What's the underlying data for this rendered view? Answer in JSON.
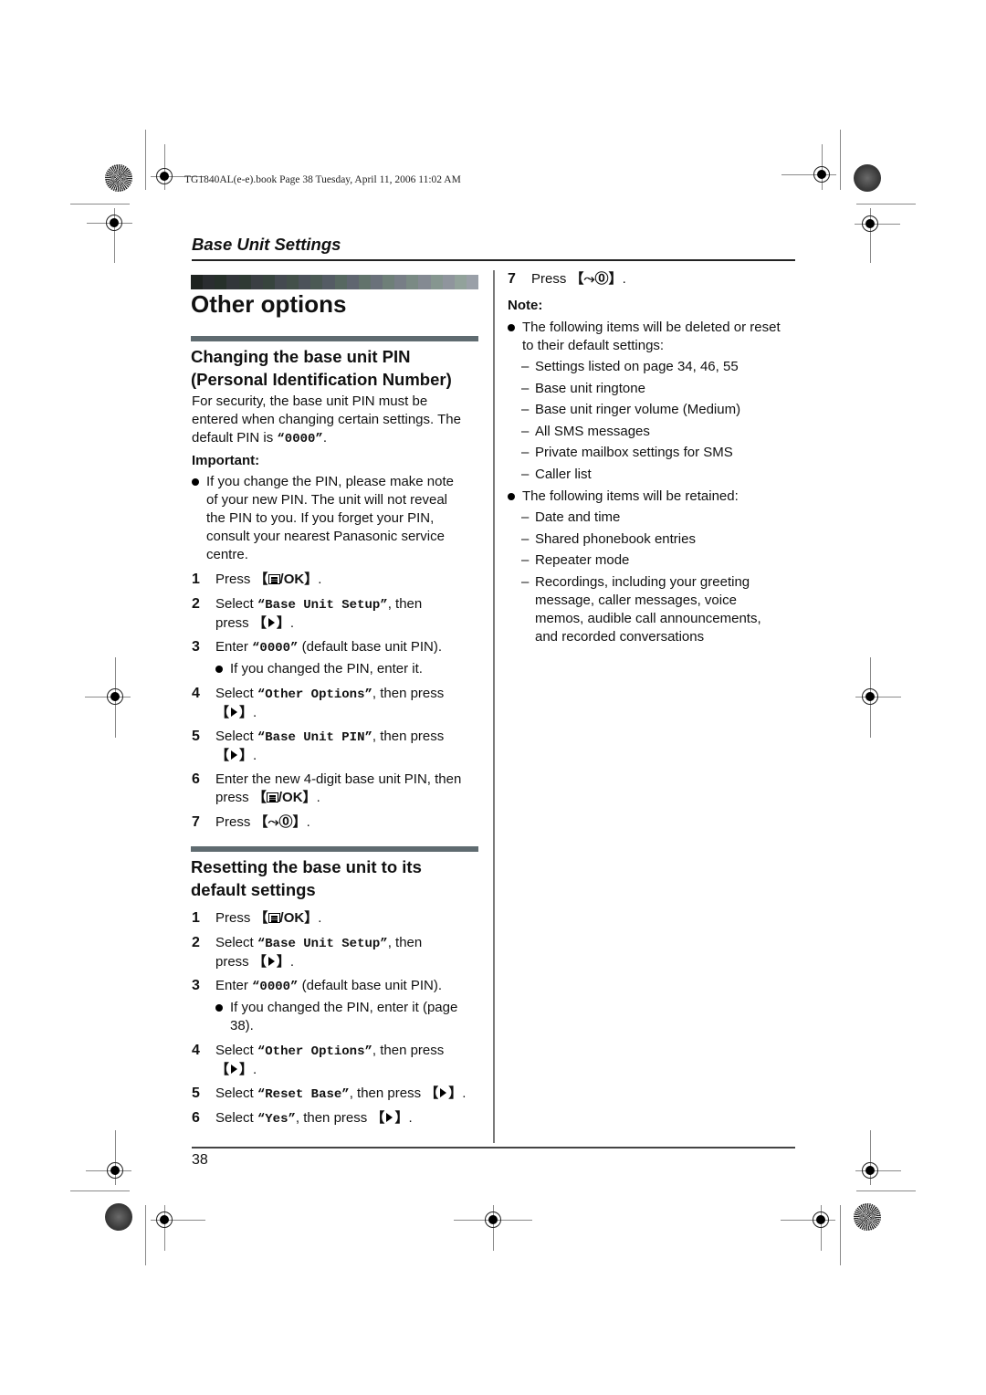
{
  "print_header": "TG1840AL(e-e).book  Page 38  Tuesday, April 11, 2006  11:02 AM",
  "section_title": "Base Unit Settings",
  "page_title": "Other options",
  "page_number": "38",
  "gradient_colors": [
    "#1e2320",
    "#2a2d30",
    "#26302a",
    "#32363a",
    "#2f3a34",
    "#3a3f43",
    "#37443e",
    "#444a50",
    "#43504a",
    "#4c525a",
    "#4b5a54",
    "#545c64",
    "#576861",
    "#5f6670",
    "#62736c",
    "#6a717a",
    "#6e7f78",
    "#777e86",
    "#7a8a84",
    "#848a92",
    "#869690",
    "#8f959d",
    "#92a29b",
    "#9aa0a8"
  ],
  "change_pin": {
    "heading_line1": "Changing the base unit PIN",
    "heading_line2": "(Personal Identification Number)",
    "intro_lines": [
      "For security, the base unit PIN must be",
      "entered when changing certain settings. The",
      "default PIN is "
    ],
    "intro_pin": "“0000”",
    "intro_end": ".",
    "important_label": "Important:",
    "important_lines": [
      "If you change the PIN, please make note",
      "of your new PIN. The unit will not reveal",
      "the PIN to you. If you forget your PIN,",
      "consult your nearest Panasonic service",
      "centre."
    ],
    "steps": [
      {
        "num": "1",
        "pre": "Press ",
        "key_open": "【",
        "key_text": "/OK",
        "key_close": "】",
        "post": "."
      },
      {
        "num": "2",
        "pre": "Select ",
        "code": "“Base Unit Setup”",
        "mid": ", then",
        "line2": "press "
      },
      {
        "num": "3",
        "pre": "Enter ",
        "code": "“0000”",
        "post": " (default base unit PIN).",
        "sub_bullet": "If you changed the PIN, enter it."
      },
      {
        "num": "4",
        "pre": "Select ",
        "code": "“Other Options”",
        "mid": ", then press"
      },
      {
        "num": "5",
        "pre": "Select ",
        "code": "“Base Unit PIN”",
        "mid": ", then press"
      },
      {
        "num": "6",
        "line1": "Enter the new 4-digit base unit PIN, then",
        "line2": "press "
      },
      {
        "num": "7",
        "pre": "Press "
      }
    ]
  },
  "reset": {
    "heading_line1": "Resetting the base unit to its",
    "heading_line2": "default settings",
    "steps": [
      {
        "num": "1",
        "pre": "Press "
      },
      {
        "num": "2",
        "pre": "Select ",
        "code": "“Base Unit Setup”",
        "mid": ", then",
        "line2": "press "
      },
      {
        "num": "3",
        "pre": "Enter ",
        "code": "“0000”",
        "post": " (default base unit PIN).",
        "sub_bullet_line1": "If you changed the PIN, enter it (page",
        "sub_bullet_line2": "38)."
      },
      {
        "num": "4",
        "pre": "Select ",
        "code": "“Other Options”",
        "mid": ", then press"
      },
      {
        "num": "5",
        "pre": "Select ",
        "code": "“Reset Base”",
        "mid": ", then press "
      },
      {
        "num": "6",
        "pre": "Select ",
        "code": "“Yes”",
        "mid": ", then press "
      },
      {
        "num": "7",
        "pre": "Press "
      }
    ],
    "note_label": "Note:",
    "deleted_intro_line1": "The following items will be deleted or reset",
    "deleted_intro_line2": "to their default settings:",
    "deleted_items": [
      "Settings listed on page 34, 46, 55",
      "Base unit ringtone",
      "Base unit ringer volume (Medium)",
      "All SMS messages",
      "Private mailbox settings for SMS",
      "Caller list"
    ],
    "retained_intro": "The following items will be retained:",
    "retained_items": [
      "Date and time",
      "Shared phonebook entries",
      "Repeater mode"
    ],
    "retained_last_lines": [
      "Recordings, including your greeting",
      "message, caller messages, voice",
      "memos, audible call announcements,",
      "and recorded conversations"
    ]
  },
  "keys": {
    "open": "【",
    "close": "】",
    "ok_text": "/OK",
    "off_text": "⤳⓪",
    "dash": "–"
  }
}
